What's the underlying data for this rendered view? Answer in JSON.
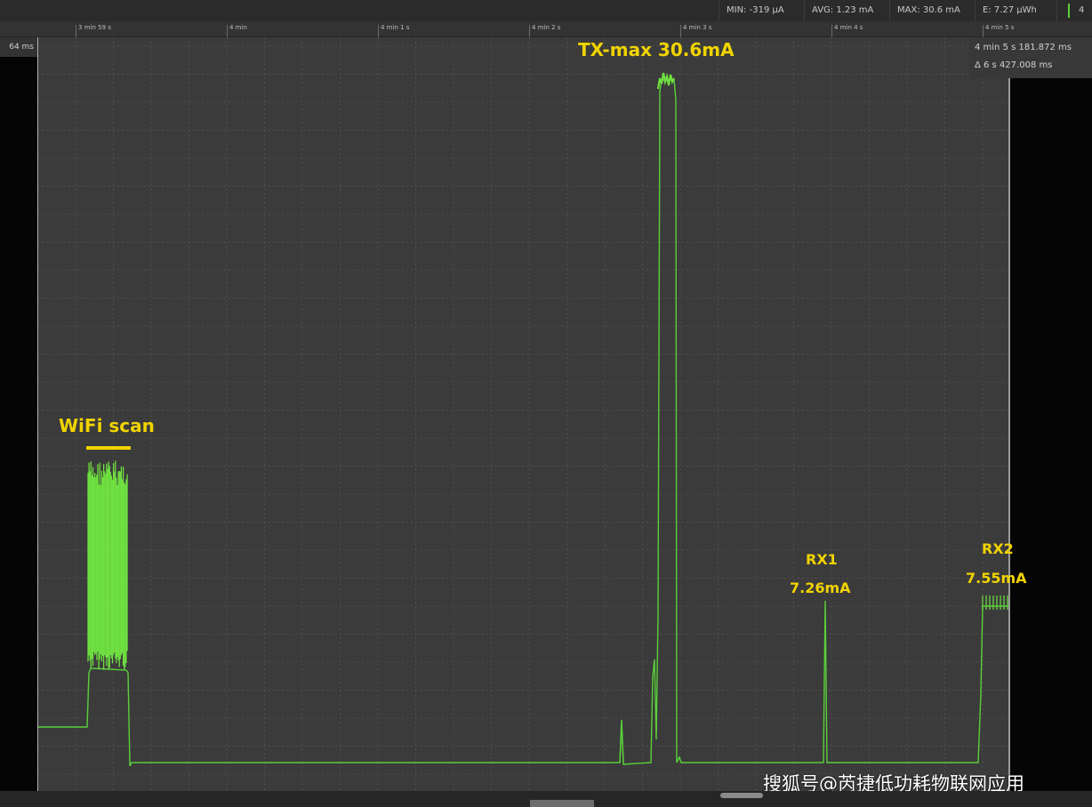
{
  "stats": {
    "min": "MIN: -319 µA",
    "avg": "AVG: 1.23 mA",
    "max": "MAX: 30.6 mA",
    "energy": "E: 7.27 µWh",
    "end": "4"
  },
  "ruler": {
    "labels": [
      "3 min 59 s",
      "4 min",
      "4 min 1 s",
      "4 min 2 s",
      "4 min 3 s",
      "4 min 4 s",
      "4 min 5 s"
    ]
  },
  "window_label": "64 ms",
  "cursor": {
    "time": "4 min 5 s 181.872 ms",
    "delta": "Δ 6 s 427.008 ms"
  },
  "annotations": {
    "tx": "TX-max 30.6mA",
    "wifi": "WiFi scan",
    "rx1_name": "RX1",
    "rx1_value": "7.26mA",
    "rx2_name": "RX2",
    "rx2_value": "7.55mA"
  },
  "watermark": "搜狐号@芮捷低功耗物联网应用",
  "colors": {
    "trace": "#5ad03a",
    "annotation": "#f0d400",
    "plot_bg": "#3b3b3b"
  }
}
